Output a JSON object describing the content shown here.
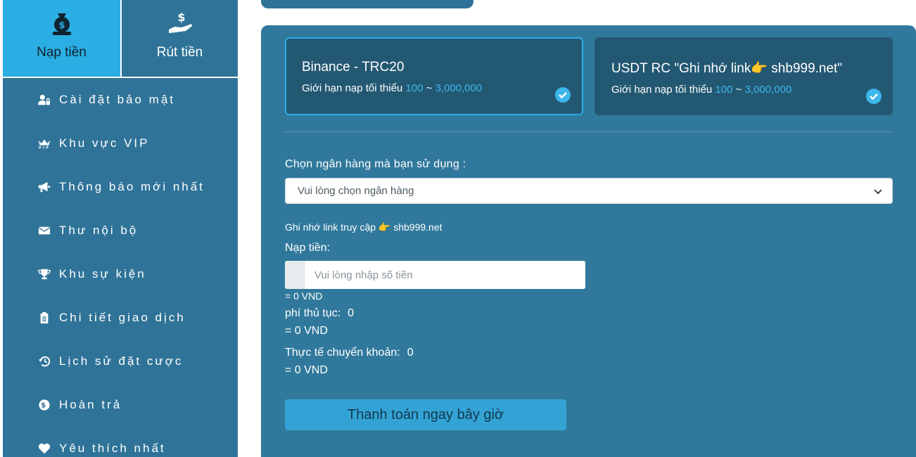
{
  "sidebar": {
    "tabs": [
      {
        "label": "Nạp tiền",
        "icon": "money-bag-icon",
        "active": true
      },
      {
        "label": "Rút tiền",
        "icon": "withdraw-hand-icon",
        "active": false
      }
    ],
    "items": [
      {
        "label": "Cài đặt bảo mật",
        "icon": "user-lock-icon"
      },
      {
        "label": "Khu vực VIP",
        "icon": "vip-crown-icon"
      },
      {
        "label": "Thông báo mới nhất",
        "icon": "megaphone-icon"
      },
      {
        "label": "Thư nội bộ",
        "icon": "envelope-icon"
      },
      {
        "label": "Khu sự kiện",
        "icon": "trophy-icon"
      },
      {
        "label": "Chi tiết giao dịch",
        "icon": "clipboard-icon"
      },
      {
        "label": "Lịch sử đặt cược",
        "icon": "history-icon"
      },
      {
        "label": "Hoàn trả",
        "icon": "dollar-circle-icon"
      },
      {
        "label": "Yêu thích nhất",
        "icon": "heart-icon"
      }
    ]
  },
  "channels": [
    {
      "name": "Binance - TRC20",
      "limit_text": "Giới hạn nạp tối thiểu",
      "min": "100",
      "sep": "~",
      "max": "3,000,000",
      "selected": true
    },
    {
      "name": "USDT RC \"Ghi nhớ link",
      "name_tail": " shb999.net\"",
      "limit_text": "Giới hạn nạp tối thiểu",
      "min": "100",
      "sep": "~",
      "max": "3,000,000",
      "selected": false
    }
  ],
  "form": {
    "bank_label": "Chọn ngân hàng mà bạn sử dụng :",
    "bank_placeholder": "Vui lòng chọn ngân hàng",
    "remember_text": "Ghi nhớ link truy cập",
    "remember_link": "shb999.net",
    "deposit_label": "Nạp tiền:",
    "amount_placeholder": "Vui lòng nhập số tiền",
    "amount_conversion": "= 0 VND",
    "fee_label": "phí thủ tục:",
    "fee_value": "0",
    "fee_conversion": "= 0 VND",
    "actual_label": "Thực tế chuyển khoản:",
    "actual_value": "0",
    "actual_conversion": "= 0 VND",
    "pay_button": "Thanh toán ngay bây giờ"
  },
  "colors": {
    "panel": "#31799c",
    "sidebar": "#2f7398",
    "accent": "#2baee3",
    "card": "#235872"
  }
}
